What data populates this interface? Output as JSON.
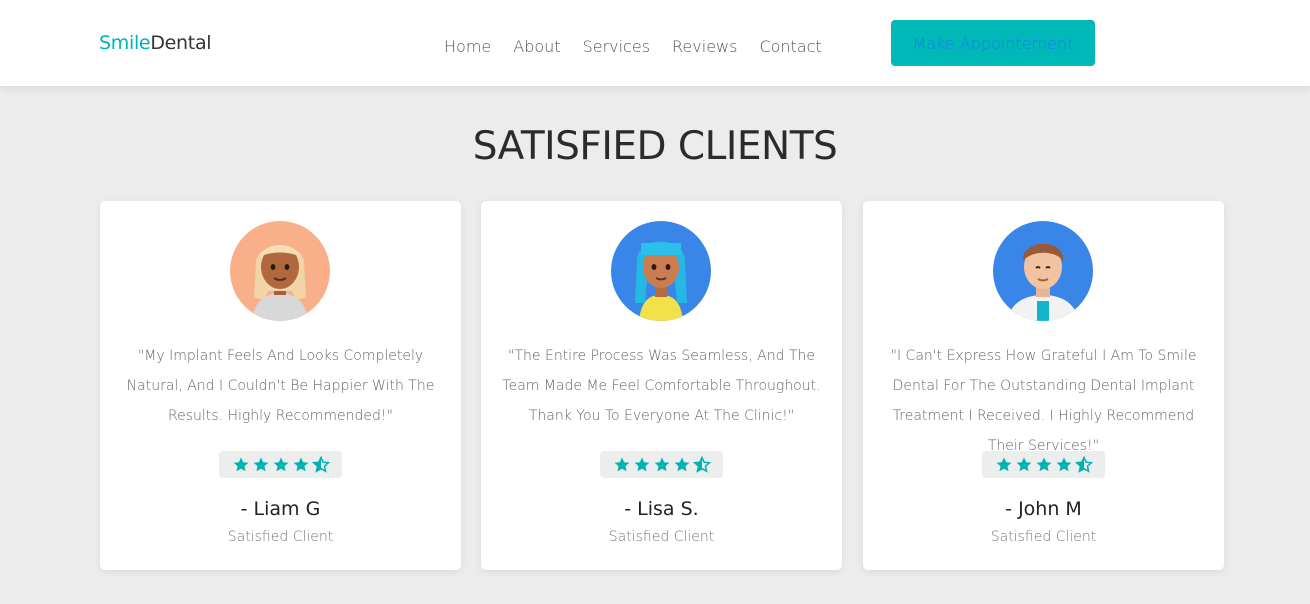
{
  "brand": {
    "part1": "Smile",
    "part2": "Dental",
    "accent": "#00b3b3"
  },
  "nav": {
    "items": [
      "Home",
      "About",
      "Services",
      "Reviews",
      "Contact"
    ]
  },
  "cta": {
    "label": "Make Appointement"
  },
  "section": {
    "title": "SATISFIED CLIENTS"
  },
  "testimonials": [
    {
      "quote": "\"My Implant Feels And Looks Completely Natural, And I Couldn't Be Happier With The Results. Highly Recommended!\"",
      "name": "- Liam G",
      "role": "Satisfied Client",
      "rating": 4.5,
      "avatar_icon": "woman-avatar-icon"
    },
    {
      "quote": "\"The Entire Process Was Seamless, And The Team Made Me Feel Comfortable Throughout. Thank You To Everyone At The Clinic!\"",
      "name": "- Lisa S.",
      "role": "Satisfied Client",
      "rating": 4.5,
      "avatar_icon": "woman-avatar-icon"
    },
    {
      "quote": "\"I Can't Express How Grateful I Am To Smile Dental For The Outstanding Dental Implant Treatment I Received. I Highly Recommend Their Services!\"",
      "name": "- John M",
      "role": "Satisfied Client",
      "rating": 4.5,
      "avatar_icon": "man-avatar-icon"
    }
  ],
  "colors": {
    "star": "#00b3b3",
    "cta_bg": "#00b8b8",
    "cta_text": "#1a7fe6"
  }
}
